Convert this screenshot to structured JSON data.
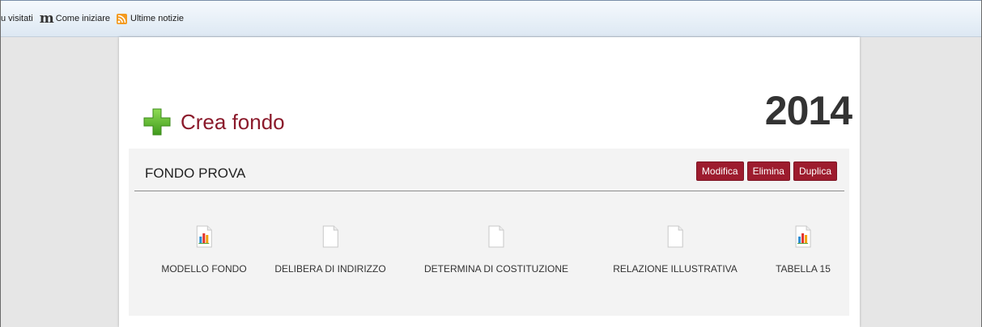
{
  "browser": {
    "bookmarks": [
      {
        "label": "u visitati",
        "icon": ""
      },
      {
        "label": "Come iniziare",
        "icon": "mozilla-m-icon"
      },
      {
        "label": "Ultime notizie",
        "icon": "rss-feed-icon"
      }
    ]
  },
  "page": {
    "create_label": "Crea fondo",
    "year": "2014",
    "fondo": {
      "name": "FONDO PROVA",
      "actions": {
        "edit": "Modifica",
        "delete": "Elimina",
        "duplicate": "Duplica"
      },
      "documents": [
        {
          "label": "MODELLO FONDO",
          "icon": "chart-document-icon"
        },
        {
          "label": "DELIBERA DI INDIRIZZO",
          "icon": "blank-document-icon"
        },
        {
          "label": "DETERMINA DI COSTITUZIONE",
          "icon": "blank-document-icon"
        },
        {
          "label": "RELAZIONE ILLUSTRATIVA",
          "icon": "blank-document-icon"
        },
        {
          "label": "TABELLA 15",
          "icon": "chart-document-icon"
        }
      ]
    }
  },
  "colors": {
    "accent": "#9d1c2e",
    "title": "#8b1a2b",
    "plus": "#5cb82e"
  }
}
